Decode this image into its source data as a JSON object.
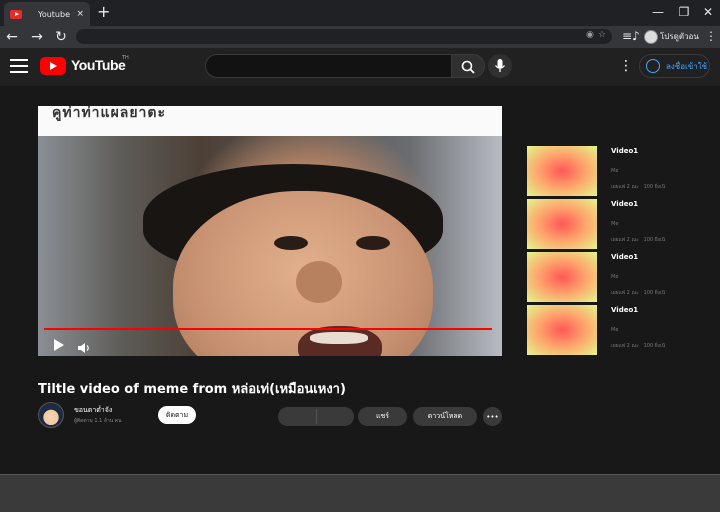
{
  "browser": {
    "tab_title": "Youtube",
    "tab_close": "×",
    "new_tab": "+",
    "win_min": "—",
    "win_restore": "❐",
    "win_close": "✕",
    "back": "←",
    "forward": "→",
    "reload": "↻",
    "omnibox_eye": "◉",
    "omnibox_star": "☆",
    "playlist": "≡♪",
    "profile_label": "โปรดูตัวอน",
    "menu": "⋮"
  },
  "youtube": {
    "logo_text": "YouTube",
    "logo_tm": "TH",
    "search_icon": "search-icon",
    "mic_icon": "mic-icon",
    "more": "⋮",
    "signin_label": "ลงชื่อเข้าใช้"
  },
  "player": {
    "caption_overlay": "คูท่าท่าแผลยาตะ",
    "progress": 1.0
  },
  "recommendations": [
    {
      "title": "Video1",
      "channel": "Me",
      "age": "เผยแพ่ 2 ณะ",
      "views": "100 ยิ่งเนิ"
    },
    {
      "title": "Video1",
      "channel": "Me",
      "age": "เผยแพ่ 2 ณะ",
      "views": "100 ยิ่งเนิ"
    },
    {
      "title": "Video1",
      "channel": "Me",
      "age": "เผยแพ่ 2 ณะ",
      "views": "100 ยิ่งเนิ"
    },
    {
      "title": "Video1",
      "channel": "Me",
      "age": "เผยแพ่ 2 ณะ",
      "views": "100 ยิ่งเนิ"
    }
  ],
  "video": {
    "title": "Tiltle video of meme from หล่อเท่(เหมือนเหงา)",
    "channel_name": "ขอนตาต่ำจัง",
    "channel_subs": "ผู้ติดตาม 1.1 ล้าน คน",
    "subscribe_label": "ติดตาม",
    "like_label": "",
    "dislike_label": "",
    "share_label": "แชร์",
    "download_label": "ดาวน์โหลด",
    "more_label": "•••"
  },
  "colors": {
    "accent_red": "#ff0000",
    "link_blue": "#3ea6ff",
    "bg": "#181818"
  }
}
